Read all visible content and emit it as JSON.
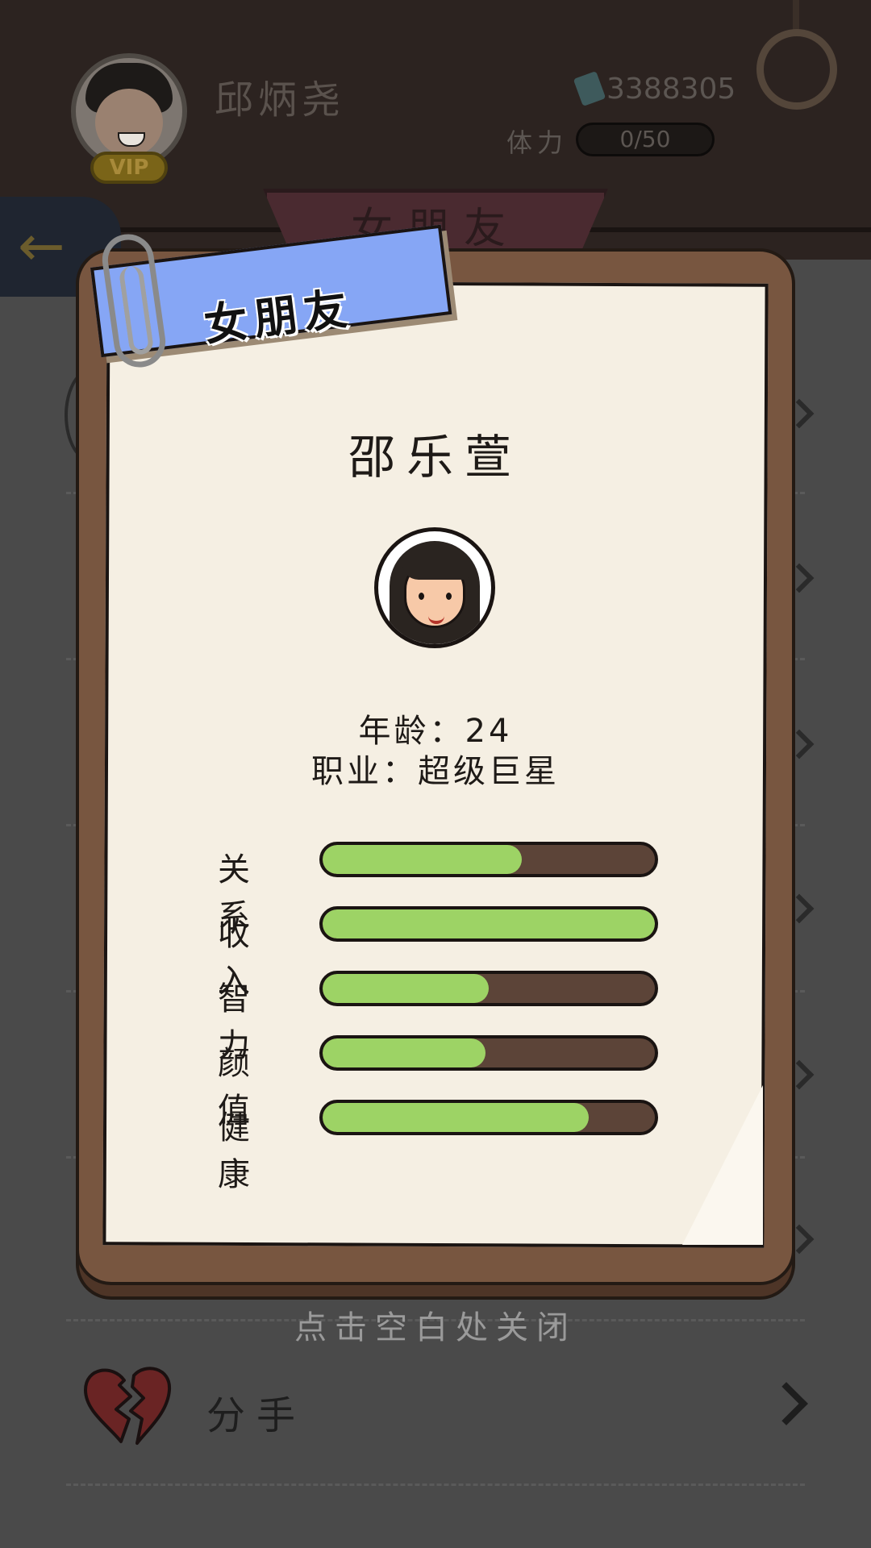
{
  "header": {
    "player_name": "邱炳尧",
    "vip_label": "VIP",
    "money": "3388305",
    "stamina_label": "体力",
    "stamina_value": "0/50",
    "ribbon_title": "女朋友"
  },
  "modal": {
    "tag_title": "女朋友",
    "name": "邵乐萱",
    "age_line": "年龄：24",
    "job_line": "职业：超级巨星",
    "stats": [
      {
        "label": "关系",
        "fill": 0.6
      },
      {
        "label": "收入",
        "fill": 1.0
      },
      {
        "label": "智力",
        "fill": 0.5
      },
      {
        "label": "颜值",
        "fill": 0.49
      },
      {
        "label": "健康",
        "fill": 0.8
      }
    ],
    "close_hint": "点击空白处关闭"
  },
  "list": {
    "breakup_label": "分手"
  },
  "colors": {
    "bar_fill": "#9dd365",
    "bar_track": "#5c4438",
    "tag_blue": "#86a6f5",
    "board_brown": "#785640",
    "paper": "#f5efe3"
  },
  "icons": {
    "back": "arrow-left-icon",
    "money": "money-icon",
    "clip": "paperclip-icon",
    "breakup": "broken-heart-icon",
    "chevron": "chevron-right-icon"
  }
}
